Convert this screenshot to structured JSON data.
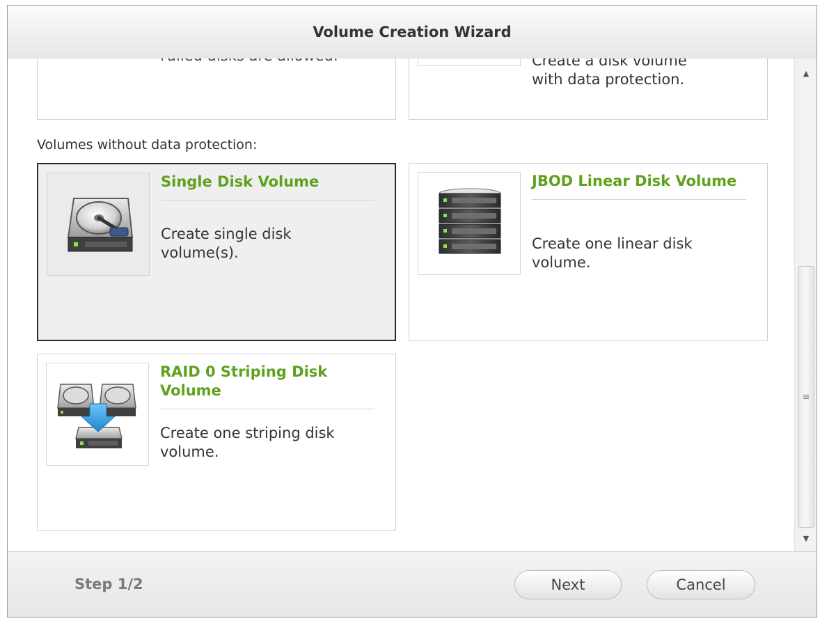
{
  "window": {
    "title": "Volume Creation Wizard"
  },
  "partial_top": {
    "left_card_text": "Failed disks are allowed.",
    "right_card_text_line1": "Create a disk volume",
    "right_card_text_line2": "with data protection."
  },
  "section": {
    "without_protection_label": "Volumes without data protection:"
  },
  "options": [
    {
      "title": "Single Disk Volume",
      "description": "Create single disk volume(s).",
      "icon": "single-disk-icon",
      "selected": true
    },
    {
      "title": "JBOD Linear Disk Volume",
      "description": "Create one linear disk volume.",
      "icon": "jbod-disk-stack-icon",
      "selected": false
    },
    {
      "title": "RAID 0 Striping Disk Volume",
      "description": "Create one striping disk volume.",
      "icon": "raid0-striping-icon",
      "selected": false
    }
  ],
  "footer": {
    "step": "Step 1/2",
    "next_label": "Next",
    "cancel_label": "Cancel"
  },
  "colors": {
    "title_green": "#5ea21c",
    "selected_border": "#2a2a2a",
    "arrow_blue": "#2f9be0"
  }
}
